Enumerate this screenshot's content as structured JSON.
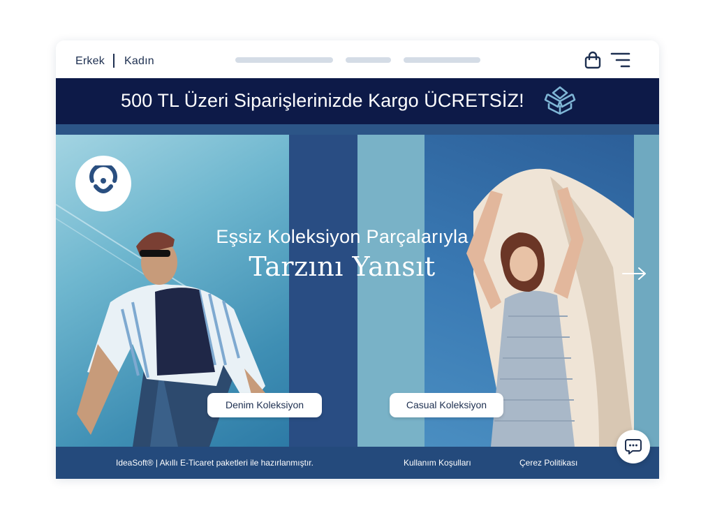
{
  "header": {
    "nav": [
      {
        "label": "Erkek"
      },
      {
        "label": "Kadın"
      }
    ],
    "icons": {
      "cart": "shopping-bag-icon",
      "menu": "menu-icon"
    }
  },
  "announcement": {
    "text": "500 TL Üzeri Siparişlerinizde Kargo ÜCRETSİZ!",
    "icon": "gift-box-icon"
  },
  "hero": {
    "subtitle": "Eşsiz Koleksiyon Parçalarıyla",
    "title": "Tarzını Yansıt",
    "buttons": [
      {
        "label": "Denim Koleksiyon"
      },
      {
        "label": "Casual Koleksiyon"
      }
    ],
    "icons": {
      "logo": "brand-logo-icon",
      "next": "arrow-right-icon"
    }
  },
  "footer": {
    "credit": "IdeaSoft® | Akıllı E-Ticaret paketleri ile hazırlanmıştır.",
    "links": [
      {
        "label": "Kullanım Koşulları"
      },
      {
        "label": "Çerez Politikası"
      }
    ]
  },
  "chat": {
    "icon": "chat-bubble-icon"
  },
  "colors": {
    "navy": "#0d1a48",
    "hero_blue": "#2c5587",
    "footer_blue": "#244a7c",
    "text_dark": "#1d2f50"
  }
}
